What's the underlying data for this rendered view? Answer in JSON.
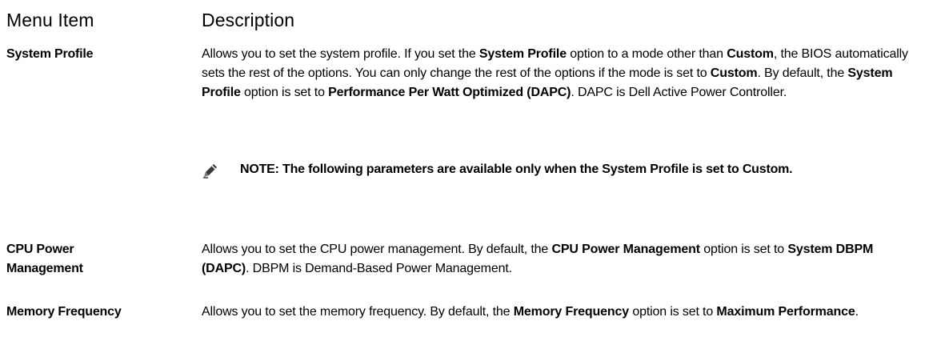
{
  "header": {
    "menu_col": "Menu Item",
    "desc_col": "Description"
  },
  "rows": [
    {
      "item": "System Profile",
      "desc": [
        {
          "t": "Allows you to set the system profile. If you set the ",
          "b": false
        },
        {
          "t": "System Profile",
          "b": true
        },
        {
          "t": " option to a mode other than ",
          "b": false
        },
        {
          "t": "Custom",
          "b": true
        },
        {
          "t": ", the BIOS automatically sets the rest of the options. You can only change the rest of the options if the mode is set to ",
          "b": false
        },
        {
          "t": "Custom",
          "b": true
        },
        {
          "t": ". By default, the ",
          "b": false
        },
        {
          "t": "System Profile",
          "b": true
        },
        {
          "t": " option is set to ",
          "b": false
        },
        {
          "t": "Performance Per Watt Optimized (DAPC)",
          "b": true
        },
        {
          "t": ". DAPC is Dell Active Power Controller.",
          "b": false
        }
      ],
      "note": "NOTE: The following parameters are available only when the System Profile is set to Custom."
    },
    {
      "item": "CPU Power Management",
      "desc": [
        {
          "t": "Allows you to set the CPU power management. By default, the ",
          "b": false
        },
        {
          "t": "CPU Power Management",
          "b": true
        },
        {
          "t": " option is set to ",
          "b": false
        },
        {
          "t": "System DBPM (DAPC)",
          "b": true
        },
        {
          "t": ". DBPM is Demand-Based Power Management.",
          "b": false
        }
      ]
    },
    {
      "item": "Memory Frequency",
      "desc": [
        {
          "t": "Allows you to set the memory frequency. By default, the ",
          "b": false
        },
        {
          "t": "Memory Frequency",
          "b": true
        },
        {
          "t": " option is set to ",
          "b": false
        },
        {
          "t": "Maximum Performance",
          "b": true
        },
        {
          "t": ".",
          "b": false
        }
      ]
    }
  ],
  "icons": {
    "note": "pencil-note-icon"
  }
}
